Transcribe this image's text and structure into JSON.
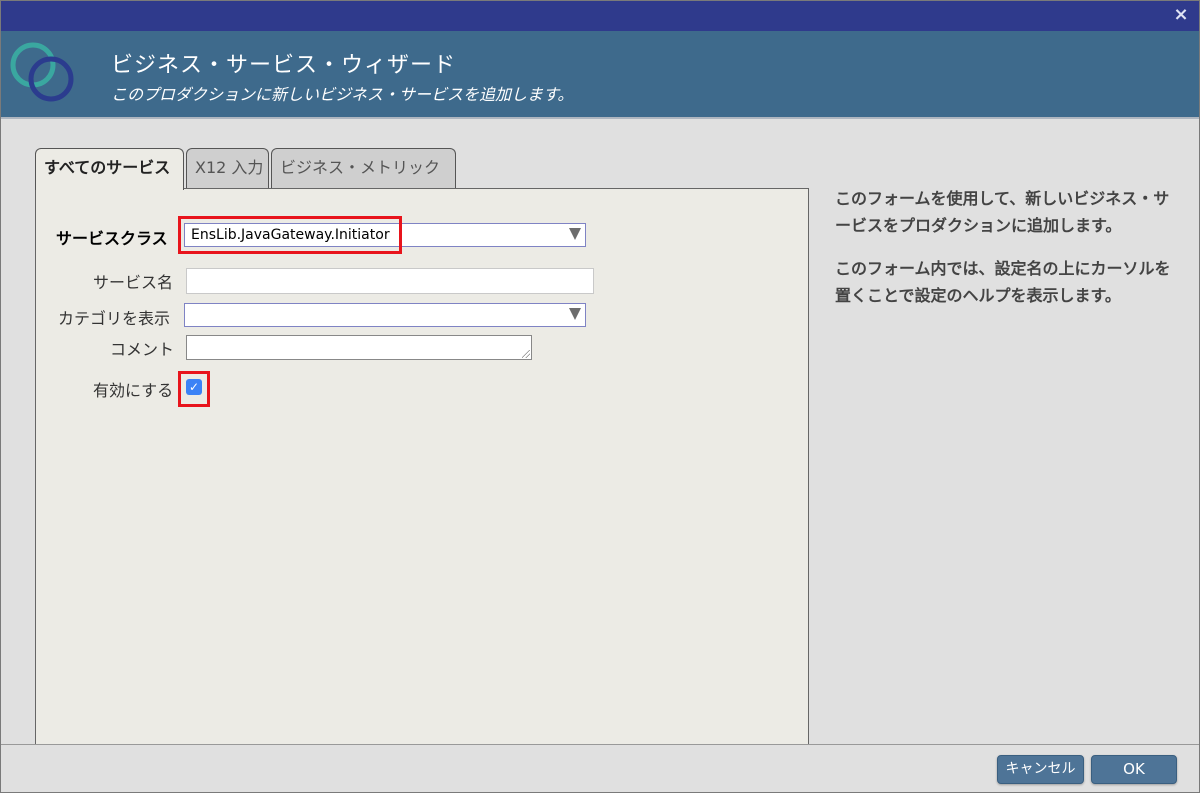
{
  "window": {
    "close_glyph": "×"
  },
  "header": {
    "title": "ビジネス・サービス・ウィザード",
    "subtitle": "このプロダクションに新しいビジネス・サービスを追加します。"
  },
  "tabs": [
    {
      "label": "すべてのサービス",
      "active": true
    },
    {
      "label": "X12 入力",
      "active": false
    },
    {
      "label": "ビジネス・メトリック",
      "active": false
    }
  ],
  "form": {
    "service_class": {
      "label": "サービスクラス",
      "value": "EnsLib.JavaGateway.Initiator"
    },
    "service_name": {
      "label": "サービス名",
      "value": ""
    },
    "category": {
      "label": "カテゴリを表示",
      "value": ""
    },
    "comment": {
      "label": "コメント",
      "value": ""
    },
    "enabled": {
      "label": "有効にする",
      "checked": true,
      "check_glyph": "✓"
    }
  },
  "help": {
    "paragraph1": "このフォームを使用して、新しいビジネス・サービスをプロダクションに追加します。",
    "paragraph2": "このフォーム内では、設定名の上にカーソルを置くことで設定のヘルプを表示します。"
  },
  "footer": {
    "cancel_label": "キャンセル",
    "ok_label": "OK"
  },
  "colors": {
    "titlebar": "#2f3a8c",
    "header": "#3e6a8c",
    "highlight": "#e8141c",
    "button": "#4e7497",
    "checkbox": "#3b82f6"
  },
  "icons": {
    "logo": "interlocking-rings-logo",
    "close": "close-icon",
    "dropdown": "triangle-down-icon",
    "resize": "resize-grip-icon"
  }
}
